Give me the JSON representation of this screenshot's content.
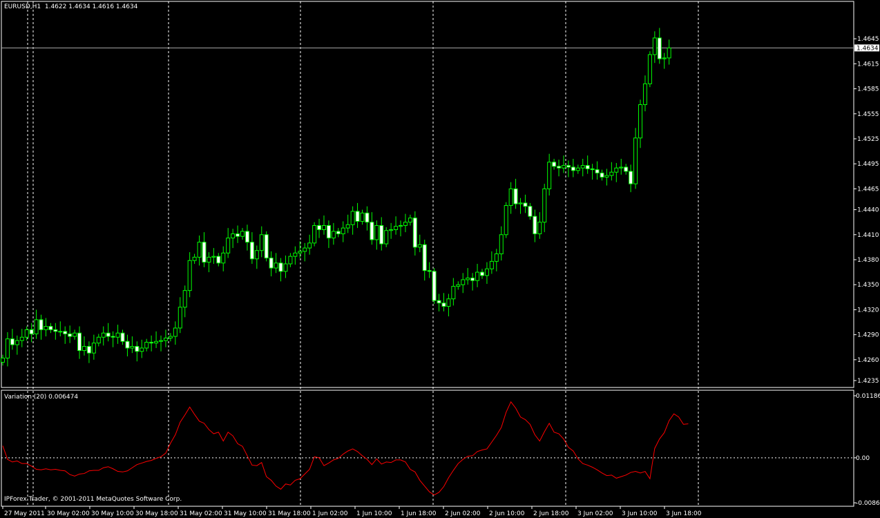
{
  "header": {
    "symbol": "EURUSD,H1",
    "ohlc": "1.4622 1.4634 1.4616 1.4634"
  },
  "indicator": {
    "label": "Variation (20) 0.006474"
  },
  "copyright": "IPForex Trader, © 2001-2011 MetaQuotes Software Corp.",
  "current_price_label": "1.4634",
  "chart_data": [
    {
      "type": "candlestick",
      "symbol": "EURUSD",
      "timeframe": "H1",
      "ylim": [
        1.4235,
        1.4665
      ],
      "yticks": [
        "1.4645",
        "1.4615",
        "1.4585",
        "1.4555",
        "1.4525",
        "1.4495",
        "1.4465",
        "1.4440",
        "1.4410",
        "1.4380",
        "1.4350",
        "1.4320",
        "1.4290",
        "1.4260",
        "1.4235"
      ],
      "xticks": [
        "27 May 2011",
        "30 May 02:00",
        "30 May 10:00",
        "30 May 18:00",
        "31 May 02:00",
        "31 May 10:00",
        "31 May 18:00",
        "1 Jun 02:00",
        "1 Jun 10:00",
        "1 Jun 18:00",
        "2 Jun 02:00",
        "2 Jun 10:00",
        "2 Jun 18:00",
        "3 Jun 02:00",
        "3 Jun 10:00",
        "3 Jun 18:00"
      ],
      "bull_color": "#00ff00",
      "bear_color": "#ffffff",
      "close": [
        1.4262,
        1.4285,
        1.4278,
        1.4283,
        1.4287,
        1.4296,
        1.4291,
        1.4308,
        1.4296,
        1.43,
        1.4296,
        1.4294,
        1.4294,
        1.4291,
        1.4288,
        1.4292,
        1.4271,
        1.4276,
        1.4268,
        1.428,
        1.4287,
        1.4292,
        1.4288,
        1.4287,
        1.4292,
        1.4282,
        1.4274,
        1.4276,
        1.427,
        1.4274,
        1.4281,
        1.428,
        1.4282,
        1.4283,
        1.4286,
        1.4288,
        1.4298,
        1.4323,
        1.4343,
        1.4379,
        1.4383,
        1.4401,
        1.4377,
        1.4383,
        1.4384,
        1.4376,
        1.4388,
        1.4406,
        1.4411,
        1.4408,
        1.4414,
        1.4401,
        1.4381,
        1.4391,
        1.441,
        1.4382,
        1.437,
        1.4376,
        1.4366,
        1.4375,
        1.4384,
        1.4388,
        1.439,
        1.4394,
        1.44,
        1.4421,
        1.4416,
        1.4421,
        1.4406,
        1.4414,
        1.4411,
        1.4418,
        1.4422,
        1.4438,
        1.4426,
        1.4436,
        1.4425,
        1.4404,
        1.4421,
        1.4399,
        1.4415,
        1.4416,
        1.442,
        1.4421,
        1.4425,
        1.443,
        1.4395,
        1.4398,
        1.4367,
        1.4366,
        1.4331,
        1.4328,
        1.4324,
        1.4333,
        1.4348,
        1.435,
        1.4356,
        1.4358,
        1.4355,
        1.4365,
        1.4361,
        1.4369,
        1.4378,
        1.4387,
        1.441,
        1.4445,
        1.4465,
        1.4447,
        1.4448,
        1.4444,
        1.4432,
        1.4411,
        1.4425,
        1.4465,
        1.4497,
        1.4492,
        1.449,
        1.4493,
        1.4491,
        1.4487,
        1.449,
        1.4493,
        1.4489,
        1.4488,
        1.4484,
        1.4479,
        1.4481,
        1.4485,
        1.449,
        1.4491,
        1.4486,
        1.4471,
        1.4526,
        1.4566,
        1.4591,
        1.4626,
        1.4646,
        1.4621,
        1.4622,
        1.4634
      ]
    },
    {
      "type": "line",
      "series": [
        {
          "name": "Variation (20)",
          "color": "#ff0000"
        }
      ],
      "ylim": [
        -0.0086,
        0.01186
      ],
      "yticks": [
        "0.01186",
        "0.00",
        "-0.00860"
      ],
      "values": [
        0.0023,
        -0.0003,
        -0.0008,
        -0.0006,
        -0.0011,
        -0.0011,
        -0.0016,
        -0.0022,
        -0.0023,
        -0.0021,
        -0.0023,
        -0.0022,
        -0.0024,
        -0.0025,
        -0.0032,
        -0.0035,
        -0.0031,
        -0.003,
        -0.0025,
        -0.0024,
        -0.0024,
        -0.0019,
        -0.0017,
        -0.0021,
        -0.0026,
        -0.0027,
        -0.0025,
        -0.0019,
        -0.0013,
        -0.001,
        -0.0007,
        -0.0005,
        -0.0001,
        0.0002,
        0.0009,
        0.0028,
        0.0044,
        0.0068,
        0.0082,
        0.0097,
        0.0083,
        0.007,
        0.0066,
        0.0054,
        0.0046,
        0.0049,
        0.0032,
        0.0049,
        0.0042,
        0.0027,
        0.0022,
        0.0004,
        -0.0014,
        -0.0015,
        -0.0009,
        -0.0036,
        -0.0043,
        -0.0054,
        -0.006,
        -0.005,
        -0.0052,
        -0.0043,
        -0.004,
        -0.0031,
        -0.0022,
        0.0002,
        0.0,
        -0.0015,
        -0.001,
        -0.0004,
        -0.0001,
        0.0007,
        0.0013,
        0.0017,
        0.0012,
        0.0004,
        -0.0003,
        -0.0013,
        -0.0002,
        -0.0012,
        -0.0008,
        -0.0009,
        -0.0004,
        -0.0004,
        -0.0008,
        -0.0022,
        -0.0027,
        -0.0043,
        -0.0054,
        -0.0065,
        -0.0071,
        -0.0066,
        -0.0055,
        -0.0038,
        -0.0024,
        -0.0011,
        -0.0003,
        0.0003,
        0.0004,
        0.0012,
        0.0015,
        0.0017,
        0.003,
        0.0043,
        0.0058,
        0.0087,
        0.0107,
        0.0095,
        0.0078,
        0.0073,
        0.0064,
        0.0044,
        0.0032,
        0.005,
        0.0066,
        0.0049,
        0.0046,
        0.0036,
        0.002,
        0.0013,
        -0.0002,
        -0.0011,
        -0.0014,
        -0.0018,
        -0.0023,
        -0.0029,
        -0.0034,
        -0.0033,
        -0.0039,
        -0.0036,
        -0.0033,
        -0.0028,
        -0.0026,
        -0.0029,
        -0.0026,
        -0.004,
        0.0018,
        0.0036,
        0.0048,
        0.0071,
        0.0084,
        0.0078,
        0.0064,
        0.0065
      ]
    }
  ]
}
